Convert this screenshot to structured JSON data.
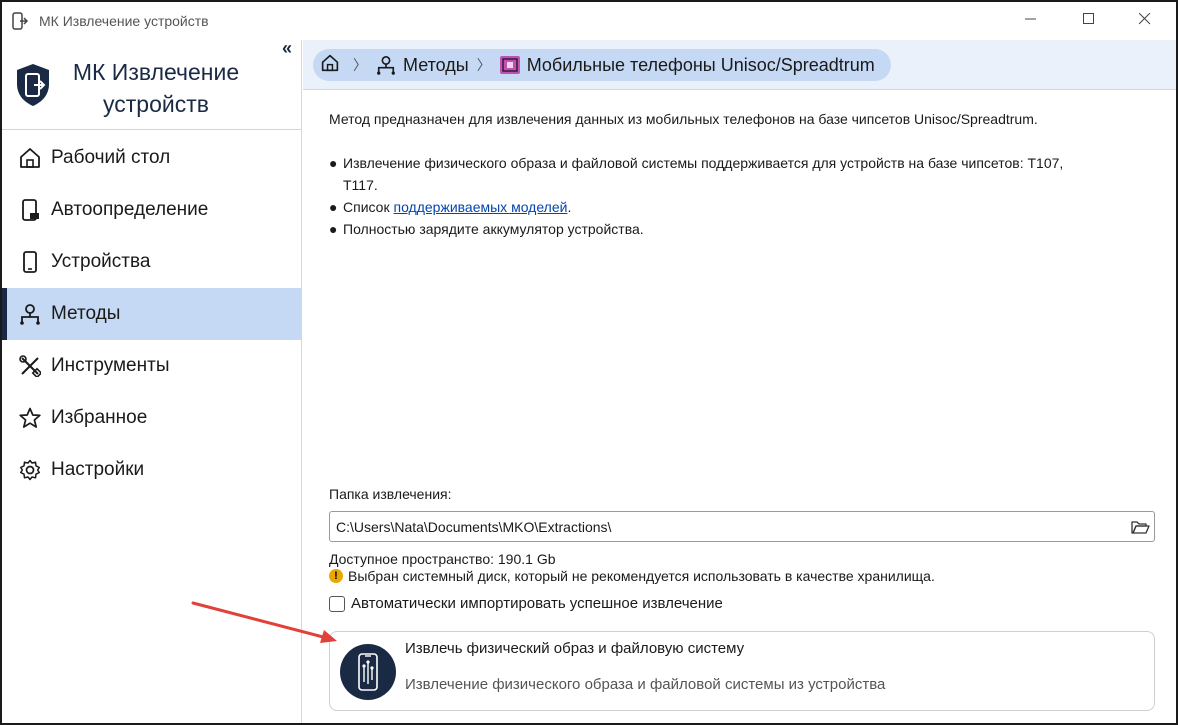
{
  "window": {
    "title": "МК Извлечение устройств",
    "controls": {
      "minimize": "minimize-icon",
      "maximize": "maximize-icon",
      "close": "close-icon"
    }
  },
  "sidebar": {
    "brand_line1": "МК Извлечение",
    "brand_line2": "устройств",
    "collapse_glyph": "«",
    "items": [
      {
        "label": "Рабочий стол",
        "icon": "home-icon"
      },
      {
        "label": "Автоопределение",
        "icon": "phone-detect-icon"
      },
      {
        "label": "Устройства",
        "icon": "devices-icon"
      },
      {
        "label": "Методы",
        "icon": "methods-icon",
        "active": true
      },
      {
        "label": "Инструменты",
        "icon": "tools-icon"
      },
      {
        "label": "Избранное",
        "icon": "star-icon"
      },
      {
        "label": "Настройки",
        "icon": "gear-icon"
      }
    ]
  },
  "breadcrumb": {
    "home_icon": "home-icon",
    "items": [
      {
        "label": "Методы",
        "icon": "methods-icon"
      },
      {
        "label": "Мобильные телефоны Unisoc/Spreadtrum",
        "icon": "chip-phone-icon"
      }
    ]
  },
  "content": {
    "description": "Метод предназначен для извлечения данных из мобильных телефонов на базе чипсетов Unisoc/Spreadtrum.",
    "bullet1_line1": "Извлечение физического образа и файловой системы поддерживается для устройств на базе чипсетов: T107,",
    "bullet1_line2": "T117.",
    "bullet2_prefix": "Список ",
    "bullet2_link": "поддерживаемых моделей",
    "bullet2_suffix": ".",
    "bullet3": "Полностью зарядите аккумулятор устройства.",
    "bullet_glyph": "●"
  },
  "folder": {
    "label": "Папка извлечения:",
    "path": "C:\\Users\\Nata\\Documents\\MKO\\Extractions\\",
    "browse_icon": "folder-open-icon",
    "space": "Доступное пространство: 190.1 Gb",
    "warning_glyph": "!",
    "warning": "Выбран системный диск, который не рекомендуется использовать в качестве хранилища.",
    "auto_import_label": "Автоматически импортировать успешное извлечение",
    "auto_import_checked": false
  },
  "extract_card": {
    "title": "Извлечь физический образ и файловую систему",
    "subtitle": "Извлечение физического образа и файловой системы из устройства",
    "icon": "phone-extract-icon"
  },
  "colors": {
    "accent_dark": "#1b2a44",
    "active_bg": "#c5d9f5",
    "breadcrumb_bg": "#eaf1fb",
    "arrow": "#e0413a",
    "link": "#0645ad"
  }
}
